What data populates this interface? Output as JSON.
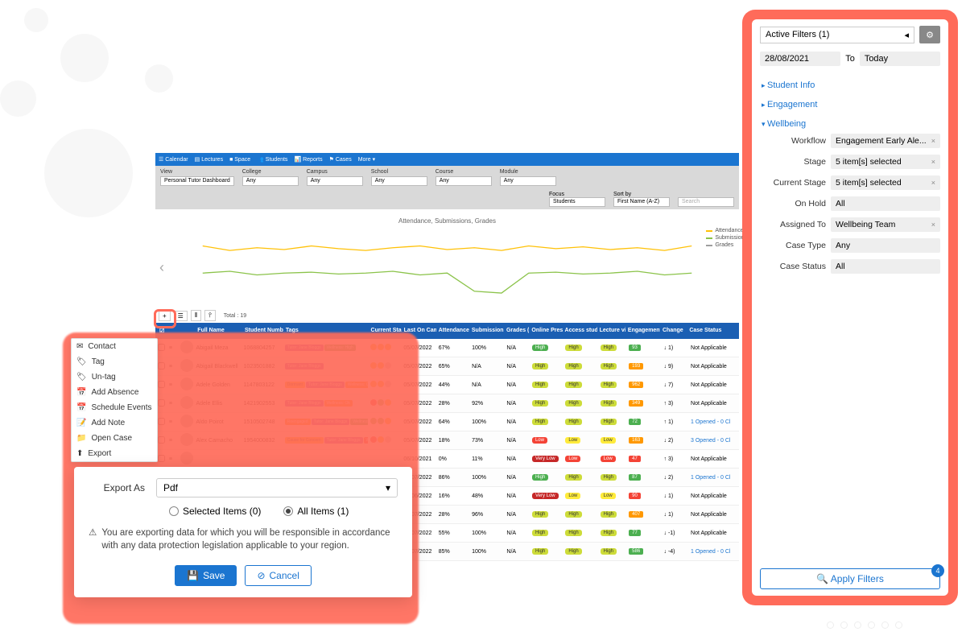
{
  "chart_data": {
    "type": "line",
    "title": "Attendance, Submissions, Grades",
    "series": [
      {
        "name": "Attendance",
        "color": "#ffc107"
      },
      {
        "name": "Submissions",
        "color": "#8bc34a"
      },
      {
        "name": "Grades",
        "color": "#9e9e9e"
      }
    ],
    "ylim": [
      0,
      100
    ]
  },
  "nav": {
    "items": [
      "Calendar",
      "Lectures",
      "Space",
      "Students",
      "Reports",
      "Cases",
      "More"
    ]
  },
  "filterbar": {
    "view_label": "View",
    "view_value": "Personal Tutor Dashboard",
    "college_label": "College",
    "college_value": "Any",
    "campus_label": "Campus",
    "campus_value": "Any",
    "school_label": "School",
    "school_value": "Any",
    "course_label": "Course",
    "course_value": "Any",
    "module_label": "Module",
    "module_value": "Any",
    "focus_label": "Focus",
    "focus_value": "Students",
    "sort_label": "Sort by",
    "sort_value": "First Name (A-Z)",
    "search_placeholder": "Search"
  },
  "toolbar": {
    "total": "Total : 19"
  },
  "table": {
    "headers": {
      "name": "Full Name",
      "number": "Student Number",
      "tags": "Tags",
      "stage": "Current Stage",
      "last": "Last On Campus",
      "att": "Attendance (%)",
      "sub": "Submissions (%)",
      "gr": "Grades (%)",
      "op": "Online Presence",
      "as": "Access study",
      "lv": "Lecture video",
      "eng": "Engagement",
      "ch": "Change",
      "cs": "Case Status"
    },
    "rows": [
      {
        "name": "Abigail Meza",
        "num": "1068804257",
        "tags": [
          {
            "t": "Tutor: Jane Bloggs",
            "c": "t-purple"
          },
          {
            "t": "Wellness: High",
            "c": "t-green"
          }
        ],
        "stage": [
          "d-y",
          "d-y",
          "d-y"
        ],
        "last": "05/07/2022",
        "att": "67%",
        "sub": "100%",
        "gr": "N/A",
        "op": {
          "t": "High",
          "c": "p-green"
        },
        "as": {
          "t": "High",
          "c": "p-lime"
        },
        "lv": {
          "t": "High",
          "c": "p-lime"
        },
        "eng": {
          "t": "93",
          "c": "p-green"
        },
        "ch": "↓ 1)",
        "cs": "Not Applicable"
      },
      {
        "name": "Abigail Blackwell",
        "num": "1023501882",
        "tags": [
          {
            "t": "Tutor: Jane Bloggs",
            "c": "t-purple"
          }
        ],
        "stage": [
          "d-y",
          "d-y",
          "d-gr"
        ],
        "last": "05/07/2022",
        "att": "65%",
        "sub": "N/A",
        "gr": "N/A",
        "op": {
          "t": "High",
          "c": "p-lime"
        },
        "as": {
          "t": "High",
          "c": "p-lime"
        },
        "lv": {
          "t": "High",
          "c": "p-lime"
        },
        "eng": {
          "t": "193",
          "c": "p-orange"
        },
        "ch": "↓ 9)",
        "cs": "Not Applicable"
      },
      {
        "name": "Adele Golden",
        "num": "1147803122",
        "tags": [
          {
            "t": "Dormant",
            "c": "t-yellow"
          },
          {
            "t": "Tutor: Jane Bloggs",
            "c": "t-purple"
          },
          {
            "t": "Wellness: Ok",
            "c": "t-orange"
          }
        ],
        "stage": [
          "d-y",
          "d-y",
          "d-gr"
        ],
        "last": "05/07/2022",
        "att": "44%",
        "sub": "N/A",
        "gr": "N/A",
        "op": {
          "t": "High",
          "c": "p-lime"
        },
        "as": {
          "t": "High",
          "c": "p-lime"
        },
        "lv": {
          "t": "High",
          "c": "p-lime"
        },
        "eng": {
          "t": "962",
          "c": "p-orange"
        },
        "ch": "↓ 7)",
        "cs": "Not Applicable"
      },
      {
        "name": "Adele Ellis",
        "num": "1421902553",
        "tags": [
          {
            "t": "Tutor: Jane Bloggs",
            "c": "t-purple"
          },
          {
            "t": "Wellness: Ok",
            "c": "t-orange"
          }
        ],
        "stage": [
          "d-r",
          "d-g",
          "d-y"
        ],
        "last": "05/07/2022",
        "att": "28%",
        "sub": "92%",
        "gr": "N/A",
        "op": {
          "t": "High",
          "c": "p-lime"
        },
        "as": {
          "t": "High",
          "c": "p-lime"
        },
        "lv": {
          "t": "High",
          "c": "p-lime"
        },
        "eng": {
          "t": "349",
          "c": "p-orange"
        },
        "ch": "↑ 3)",
        "cs": "Not Applicable"
      },
      {
        "name": "Aldo Poirot",
        "num": "1510502748",
        "tags": [
          {
            "t": "Reengaged",
            "c": "t-orange"
          },
          {
            "t": "Tutor: Jane Bloggs",
            "c": "t-purple"
          },
          {
            "t": "Wellness: High",
            "c": "t-green"
          }
        ],
        "stage": [
          "d-g",
          "d-g",
          "d-y"
        ],
        "last": "05/07/2022",
        "att": "64%",
        "sub": "100%",
        "gr": "N/A",
        "op": {
          "t": "High",
          "c": "p-lime"
        },
        "as": {
          "t": "High",
          "c": "p-lime"
        },
        "lv": {
          "t": "High",
          "c": "p-lime"
        },
        "eng": {
          "t": "72",
          "c": "p-green"
        },
        "ch": "↑ 1)",
        "cs": "1 Opened - 0 Cl"
      },
      {
        "name": "Alex Camacho",
        "num": "1954000832",
        "tags": [
          {
            "t": "Cause for Concern",
            "c": "t-yellow"
          },
          {
            "t": "Tutor: Jane Bloggs",
            "c": "t-purple"
          },
          {
            "t": "Wellness: Low",
            "c": "t-red"
          }
        ],
        "stage": [
          "d-r",
          "d-y",
          "d-gr"
        ],
        "last": "05/07/2022",
        "att": "18%",
        "sub": "73%",
        "gr": "N/A",
        "op": {
          "t": "Low",
          "c": "p-red"
        },
        "as": {
          "t": "Low",
          "c": "p-yellow"
        },
        "lv": {
          "t": "Low",
          "c": "p-yellow"
        },
        "eng": {
          "t": "163",
          "c": "p-orange"
        },
        "ch": "↓ 2)",
        "cs": "3 Opened - 0 Cl"
      },
      {
        "name": "",
        "num": "",
        "tags": [],
        "stage": [],
        "last": "06/10/2021",
        "att": "0%",
        "sub": "11%",
        "gr": "N/A",
        "op": {
          "t": "Very Low",
          "c": "p-darkred"
        },
        "as": {
          "t": "Low",
          "c": "p-red"
        },
        "lv": {
          "t": "Low",
          "c": "p-red"
        },
        "eng": {
          "t": "47",
          "c": "p-red"
        },
        "ch": "↑ 3)",
        "cs": "Not Applicable"
      },
      {
        "name": "",
        "num": "",
        "tags": [],
        "stage": [],
        "last": "05/07/2022",
        "att": "86%",
        "sub": "100%",
        "gr": "N/A",
        "op": {
          "t": "High",
          "c": "p-green"
        },
        "as": {
          "t": "High",
          "c": "p-lime"
        },
        "lv": {
          "t": "High",
          "c": "p-lime"
        },
        "eng": {
          "t": "87",
          "c": "p-green"
        },
        "ch": "↓ 2)",
        "cs": "1 Opened - 0 Cl"
      },
      {
        "name": "",
        "num": "",
        "tags": [],
        "stage": [],
        "last": "26/06/2022",
        "att": "16%",
        "sub": "48%",
        "gr": "N/A",
        "op": {
          "t": "Very Low",
          "c": "p-darkred"
        },
        "as": {
          "t": "Low",
          "c": "p-yellow"
        },
        "lv": {
          "t": "Low",
          "c": "p-yellow"
        },
        "eng": {
          "t": "90",
          "c": "p-red"
        },
        "ch": "↓ 1)",
        "cs": "Not Applicable"
      },
      {
        "name": "",
        "num": "",
        "tags": [],
        "stage": [],
        "last": "05/07/2022",
        "att": "28%",
        "sub": "96%",
        "gr": "N/A",
        "op": {
          "t": "High",
          "c": "p-lime"
        },
        "as": {
          "t": "High",
          "c": "p-lime"
        },
        "lv": {
          "t": "High",
          "c": "p-lime"
        },
        "eng": {
          "t": "407",
          "c": "p-orange"
        },
        "ch": "↓ 1)",
        "cs": "Not Applicable"
      },
      {
        "name": "",
        "num": "",
        "tags": [],
        "stage": [],
        "last": "05/07/2022",
        "att": "55%",
        "sub": "100%",
        "gr": "N/A",
        "op": {
          "t": "High",
          "c": "p-lime"
        },
        "as": {
          "t": "High",
          "c": "p-lime"
        },
        "lv": {
          "t": "High",
          "c": "p-lime"
        },
        "eng": {
          "t": "77",
          "c": "p-green"
        },
        "ch": "↓ -1)",
        "cs": "Not Applicable"
      },
      {
        "name": "",
        "num": "",
        "tags": [],
        "stage": [],
        "last": "05/07/2022",
        "att": "85%",
        "sub": "100%",
        "gr": "N/A",
        "op": {
          "t": "High",
          "c": "p-lime"
        },
        "as": {
          "t": "High",
          "c": "p-lime"
        },
        "lv": {
          "t": "High",
          "c": "p-lime"
        },
        "eng": {
          "t": "586",
          "c": "p-green"
        },
        "ch": "↓ -4)",
        "cs": "1 Opened - 0 Cl"
      }
    ]
  },
  "context_menu": {
    "items": [
      "Contact",
      "Tag",
      "Un-tag",
      "Add Absence",
      "Schedule Events",
      "Add Note",
      "Open Case",
      "Export"
    ]
  },
  "export": {
    "label": "Export As",
    "format": "Pdf",
    "opt_selected": "Selected Items (0)",
    "opt_all": "All Items (1)",
    "warning": "You are exporting data for which you will be responsible in accordance with any data protection legislation applicable to your region.",
    "save": "Save",
    "cancel": "Cancel"
  },
  "filters": {
    "title": "Active Filters (1)",
    "date_from": "28/08/2021",
    "date_to_label": "To",
    "date_to": "Today",
    "sec_student": "Student Info",
    "sec_engagement": "Engagement",
    "sec_wellbeing": "Wellbeing",
    "workflow_l": "Workflow",
    "workflow_v": "Engagement Early Ale...",
    "stage_l": "Stage",
    "stage_v": "5 item[s] selected",
    "cstage_l": "Current Stage",
    "cstage_v": "5 item[s] selected",
    "hold_l": "On Hold",
    "hold_v": "All",
    "assigned_l": "Assigned To",
    "assigned_v": "Wellbeing Team",
    "ctype_l": "Case Type",
    "ctype_v": "Any",
    "cstatus_l": "Case Status",
    "cstatus_v": "All",
    "apply": "Apply Filters",
    "badge": "4"
  }
}
